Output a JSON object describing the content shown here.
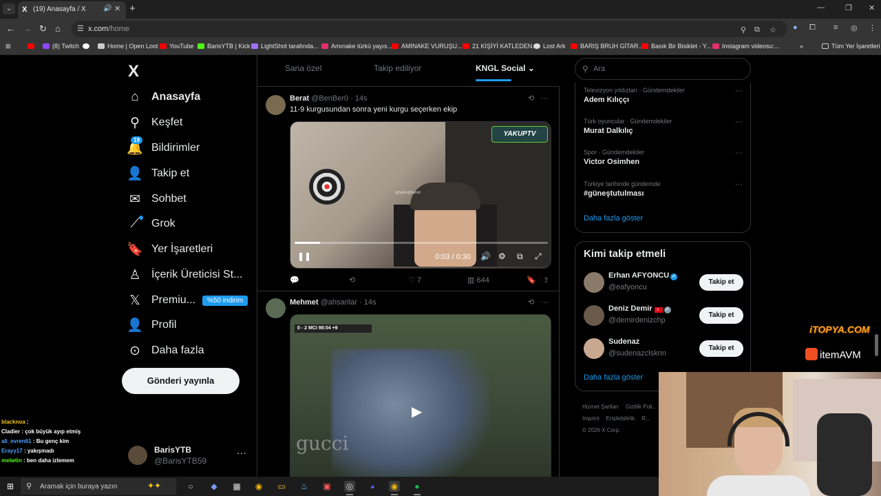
{
  "browser": {
    "tab_title": "(19) Anasayfa / X",
    "tab_favicon": "X",
    "url_domain": "x.com",
    "url_path": "/home",
    "bookmarks": [
      {
        "label": "(8) Twitch",
        "color": "#9146ff"
      },
      {
        "label": "",
        "color": "#ffffff"
      },
      {
        "label": "Home | Open Loot",
        "color": "#cccccc"
      },
      {
        "label": "YouTube",
        "color": "#ff0000"
      },
      {
        "label": "BarisYTB | Kick",
        "color": "#53fc18"
      },
      {
        "label": "LightShot tarafında...",
        "color": "#a070ff"
      },
      {
        "label": "Amınake türkü yayıs...",
        "color": "#e1306c"
      },
      {
        "label": "AMINAKE VURUŞU...",
        "color": "#ff0000"
      },
      {
        "label": "21 KİŞİYİ KATLEDEN...",
        "color": "#ff0000"
      },
      {
        "label": "Lost Ark",
        "color": "#dddddd"
      },
      {
        "label": "BARIŞ BRUH GİTAR...",
        "color": "#ff0000"
      },
      {
        "label": "Basık Bir Bisiklet - Y...",
        "color": "#ff0000"
      },
      {
        "label": "Instagram videosu:...",
        "color": "#e1306c"
      }
    ],
    "bookmarks_more": "»",
    "all_bookmarks": "Tüm Yer İşaretleri"
  },
  "nav": {
    "logo": "X",
    "items": [
      {
        "label": "Anasayfa",
        "icon": "home-icon"
      },
      {
        "label": "Keşfet",
        "icon": "search-icon"
      },
      {
        "label": "Bildirimler",
        "icon": "bell-icon"
      },
      {
        "label": "Takip et",
        "icon": "person-add-icon"
      },
      {
        "label": "Sohbet",
        "icon": "mail-icon"
      },
      {
        "label": "Grok",
        "icon": "grok-icon"
      },
      {
        "label": "Yer İşaretleri",
        "icon": "bookmark-icon"
      },
      {
        "label": "İçerik Üreticisi St...",
        "icon": "creator-studio-icon"
      },
      {
        "label": "Premiu...",
        "icon": "x-premium-icon"
      },
      {
        "label": "Profil",
        "icon": "profile-icon"
      },
      {
        "label": "Daha fazla",
        "icon": "more-circle-icon"
      }
    ],
    "notification_count": "19",
    "premium_badge": "%50 indirim",
    "post_button": "Gönderi yayınla",
    "account_name": "BarisYTB",
    "account_handle": "@BarisYTB59"
  },
  "chat": [
    {
      "user": "blacknoa",
      "msg": ":",
      "color": "#f5c518"
    },
    {
      "user": "Cladier",
      "msg": ": çok büyük ayıp etmiş",
      "color": "#ffffff"
    },
    {
      "user": "ali_evren61",
      "msg": ": Bu genç kim",
      "color": "#4fa3ff"
    },
    {
      "user": "Erayy17",
      "msg": ": yakışmadı",
      "color": "#4fa3ff"
    },
    {
      "user": "melwtin",
      "msg": ": ben daha izlemem",
      "color": "#53fc18"
    }
  ],
  "feed": {
    "tabs": [
      "Sana özel",
      "Takip ediliyor",
      "KNGL Social"
    ],
    "tweets": [
      {
        "name": "Berat",
        "handle": "@BenBer0",
        "time": "· 14s",
        "text": "11-9 kurgusundan sonra yeni kurgu seçerken ekip",
        "video_time": "0:03 / 0:30",
        "progress": 0.1,
        "video_logo": "YAKUPTV",
        "video_logo_prefix": "kick",
        "watermark": "@yakupbaran",
        "replies": "",
        "reposts": "",
        "likes": "7",
        "views": "644"
      },
      {
        "name": "Mehmet",
        "handle": "@ahsarilar",
        "time": "· 14s",
        "scoreboard": "0 - 2   MCI   98:04   +9",
        "video_watermark": "gucci"
      }
    ]
  },
  "right": {
    "search_placeholder": "Ara",
    "trends": [
      {
        "category": "Televizyon yıldızları · Gündemdekiler",
        "title": "Adem Kılıççı"
      },
      {
        "category": "Türk oyuncular · Gündemdekiler",
        "title": "Murat Dalkılıç"
      },
      {
        "category": "Spor · Gündemdekiler",
        "title": "Victor Osimhen"
      },
      {
        "category": "Türkiye tarihinde gündemde",
        "title": "#güneştutulması"
      }
    ],
    "show_more": "Daha fazla göster",
    "who_to_follow_title": "Kimi takip etmeli",
    "who_to_follow": [
      {
        "name": "Erhan AFYONCU",
        "handle": "@eafyoncu",
        "button": "Takip et",
        "avatar_color": "#8a7a6a"
      },
      {
        "name": "Deniz Demir",
        "handle": "@demirdenizchp",
        "button": "Takip et",
        "avatar_color": "#6a5a4a"
      },
      {
        "name": "Sudenaz",
        "handle": "@sudenazclsknn",
        "button": "Takip et",
        "avatar_color": "#c8a890"
      }
    ],
    "footer": [
      "Hizmet Şartları",
      "Gizlilik Poli...",
      "Imprint",
      "Erişilebilirlik",
      "R...",
      "© 2026 X Corp."
    ]
  },
  "overlays": {
    "itopya": "iTOPYA.COM",
    "itemavm": "itemAVM"
  },
  "taskbar": {
    "search_placeholder": "Aramak için buraya yazın"
  }
}
